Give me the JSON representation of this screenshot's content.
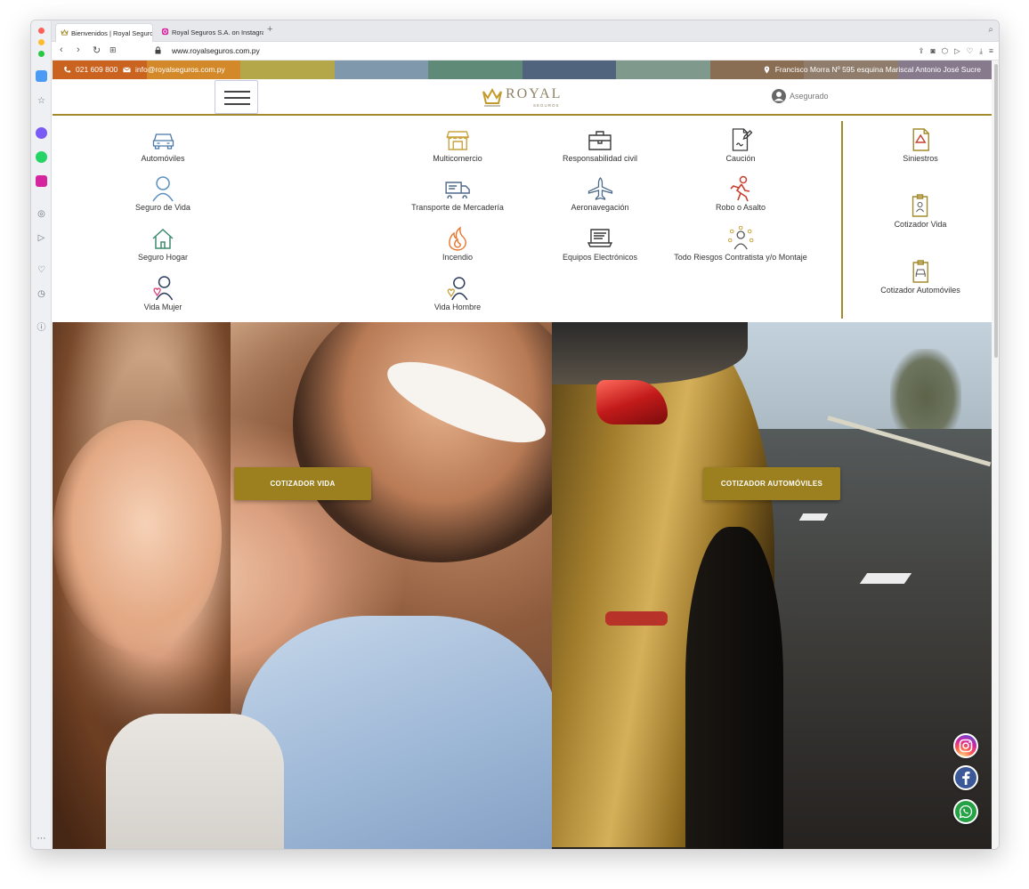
{
  "browser": {
    "tabs": [
      {
        "title": "Bienvenidos | Royal Seguros"
      },
      {
        "title": "Royal Seguros S.A. on Instagra"
      }
    ],
    "new_tab": "+",
    "url": "www.royalseguros.com.py"
  },
  "site": {
    "colors": {
      "gold": "#a38a2c",
      "cta": "#9c7f1e",
      "strip": [
        "#c9631f",
        "#d3892a",
        "#b3a74a",
        "#7f98ab",
        "#5e8a77",
        "#50657d",
        "#7f9a8c",
        "#8a6e54",
        "#8f7c6a",
        "#867a8c"
      ]
    },
    "topbar": {
      "phone": "021 609 800",
      "email": "info@royalseguros.com.py",
      "address": "Francisco Morra Nº 595 esquina Mariscal Antonio José Sucre"
    },
    "header": {
      "logo_name": "ROYAL",
      "logo_sub": "SEGUROS",
      "user_label": "Asegurado"
    },
    "menu": {
      "col1": [
        "Automóviles",
        "Seguro de Vida",
        "Seguro Hogar",
        "Vida Mujer"
      ],
      "col2": [
        "Multicomercio",
        "Transporte de Mercadería",
        "Incendio",
        "Vida Hombre"
      ],
      "col3": [
        "Responsabilidad civil",
        "Aeronavegación",
        "Equipos Electrónicos"
      ],
      "col4": [
        "Caución",
        "Robo o Asalto",
        "Todo Riesgos Contratista y/o Montaje"
      ],
      "side": [
        "Siniestros",
        "Cotizador Vida",
        "Cotizador Automóviles"
      ]
    },
    "hero": {
      "cta_left": "COTIZADOR VIDA",
      "cta_right": "COTIZADOR AUTOMÓVILES"
    }
  }
}
